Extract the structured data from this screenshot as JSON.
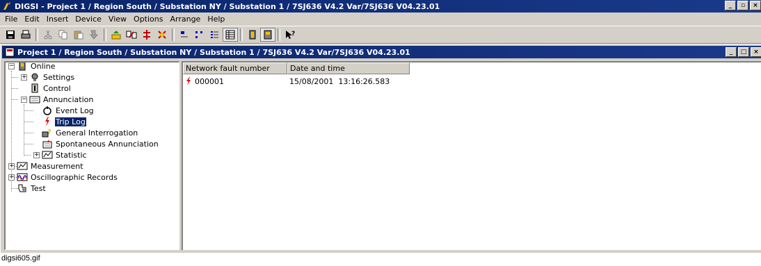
{
  "app": {
    "title": "DIGSI - Project 1 / Region South / Substation NY / Substation 1 / 7SJ636 V4.2 Var/7SJ636 V04.23.01"
  },
  "menu": [
    "File",
    "Edit",
    "Insert",
    "Device",
    "View",
    "Options",
    "Arrange",
    "Help"
  ],
  "toolbar": {
    "icons": [
      "save-icon",
      "print-icon",
      "cut-icon",
      "copy-icon",
      "paste-icon",
      "assign-icon",
      "upload-icon",
      "compare-icon",
      "initialize-icon",
      "delete-icon",
      "large-icons-icon",
      "small-icons-icon",
      "list-icon",
      "details-icon",
      "module-icon",
      "device-icon",
      "help-pointer-icon"
    ]
  },
  "document": {
    "title": "Project 1 / Region South / Substation NY / Substation 1 / 7SJ636 V4.2 Var/7SJ636 V04.23.01"
  },
  "tree": {
    "online": "Online",
    "settings": "Settings",
    "control": "Control",
    "annunciation": "Annunciation",
    "event_log": "Event Log",
    "trip_log": "Trip Log",
    "general_interrogation": "General Interrogation",
    "spontaneous_annunciation": "Spontaneous Annunciation",
    "statistic": "Statistic",
    "measurement": "Measurement",
    "oscillographic_records": "Oscillographic Records",
    "test": "Test"
  },
  "list": {
    "columns": [
      "Network fault number",
      "Date and time"
    ],
    "rows": [
      {
        "fault_number": "000001",
        "datetime": "15/08/2001  13:16:26.583"
      }
    ]
  },
  "caption": "digsi605.gif",
  "colors": {
    "titlebar": "#0a246a",
    "face": "#d4d0c8",
    "trip_icon": "#e00000"
  }
}
